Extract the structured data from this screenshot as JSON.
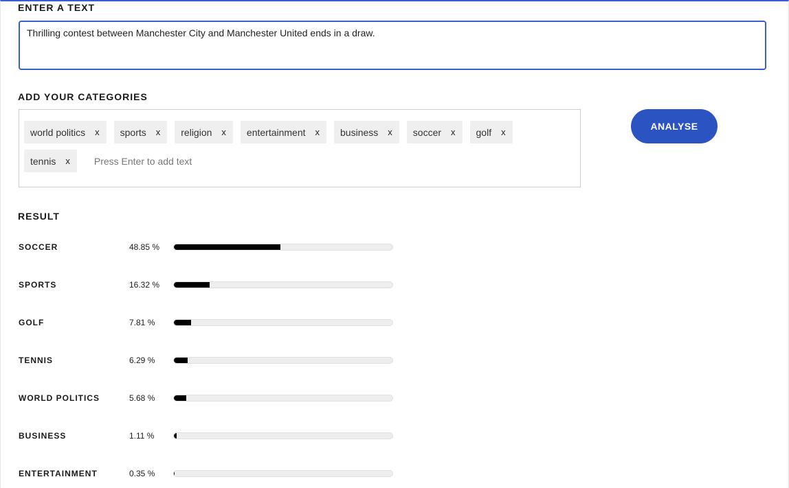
{
  "input_section": {
    "label": "ENTER A TEXT",
    "text_value": "Thrilling contest between Manchester City and Manchester United ends in a draw."
  },
  "categories_section": {
    "label": "ADD YOUR CATEGORIES",
    "tags": [
      {
        "label": "world politics",
        "remove": "x"
      },
      {
        "label": "sports",
        "remove": "x"
      },
      {
        "label": "religion",
        "remove": "x"
      },
      {
        "label": "entertainment",
        "remove": "x"
      },
      {
        "label": "business",
        "remove": "x"
      },
      {
        "label": "soccer",
        "remove": "x"
      },
      {
        "label": "golf",
        "remove": "x"
      },
      {
        "label": "tennis",
        "remove": "x"
      }
    ],
    "input_placeholder": "Press Enter to add text"
  },
  "analyse_button": {
    "label": "ANALYSE",
    "color": "#2c53c2"
  },
  "result_section": {
    "label": "RESULT",
    "bar_color": "#000000",
    "track_color": "#eeeeee",
    "rows": [
      {
        "name": "SOCCER",
        "percent_text": "48.85 %",
        "value": 48.85
      },
      {
        "name": "SPORTS",
        "percent_text": "16.32 %",
        "value": 16.32
      },
      {
        "name": "GOLF",
        "percent_text": "7.81 %",
        "value": 7.81
      },
      {
        "name": "TENNIS",
        "percent_text": "6.29 %",
        "value": 6.29
      },
      {
        "name": "WORLD POLITICS",
        "percent_text": "5.68 %",
        "value": 5.68
      },
      {
        "name": "BUSINESS",
        "percent_text": "1.11 %",
        "value": 1.11
      },
      {
        "name": "ENTERTAINMENT",
        "percent_text": "0.35 %",
        "value": 0.35
      }
    ]
  }
}
